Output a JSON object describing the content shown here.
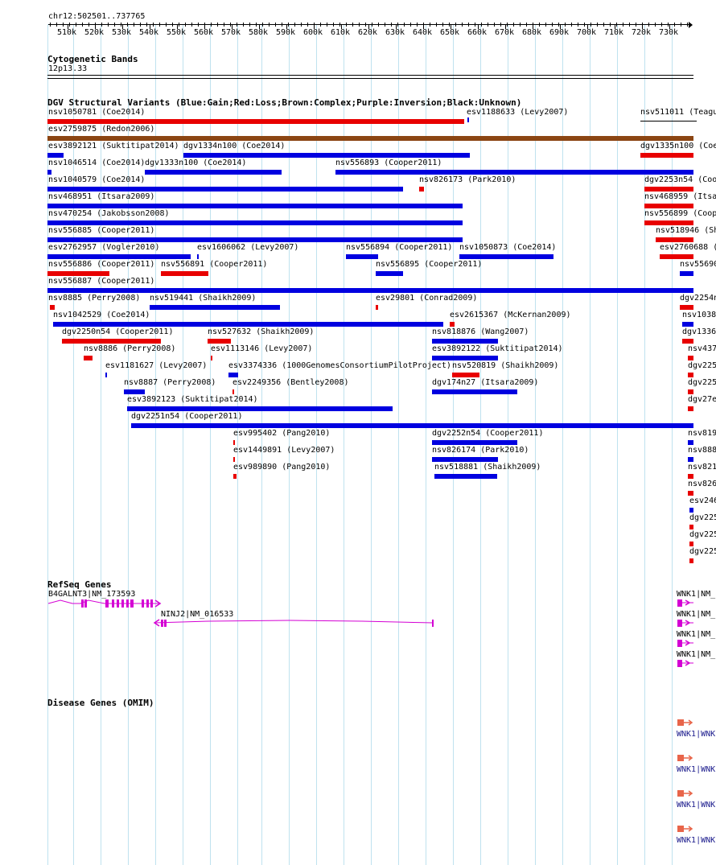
{
  "ruler": {
    "range_label": "chr12:502501..737765",
    "ticks": [
      "510k",
      "520k",
      "530k",
      "540k",
      "550k",
      "560k",
      "570k",
      "580k",
      "590k",
      "600k",
      "610k",
      "620k",
      "630k",
      "640k",
      "650k",
      "660k",
      "670k",
      "680k",
      "690k",
      "700k",
      "710k",
      "720k",
      "730k"
    ]
  },
  "cytoband": {
    "title": "Cytogenetic Bands",
    "band": "12p13.33"
  },
  "dgv": {
    "title": "DGV Structural Variants (Blue:Gain;Red:Loss;Brown:Complex;Purple:Inversion;Black:Unknown)",
    "colors": {
      "gain": "#0000e0",
      "loss": "#e80000",
      "complex": "#8b4513",
      "unknown": "#000000"
    },
    "variants": [
      {
        "label": "nsv1050781 (Coe2014)",
        "type": "loss"
      },
      {
        "label": "esv1188633 (Levy2007)",
        "type": "gain"
      },
      {
        "label": "nsv511011 (Teagu",
        "type": "unknown"
      },
      {
        "label": "esv2759875 (Redon2006)",
        "type": "complex"
      },
      {
        "label": "esv3892121 (Suktitipat2014)",
        "type": "gain"
      },
      {
        "label": "dgv1334n100 (Coe2014)",
        "type": "gain"
      },
      {
        "label": "dgv1335n100 (Coe",
        "type": "loss"
      },
      {
        "label": "nsv1046514 (Coe2014)",
        "type": "gain"
      },
      {
        "label": "dgv1333n100 (Coe2014)",
        "type": "gain"
      },
      {
        "label": "nsv556893 (Cooper2011)",
        "type": "gain"
      },
      {
        "label": "nsv1040579 (Coe2014)",
        "type": "gain"
      },
      {
        "label": "nsv826173 (Park2010)",
        "type": "loss"
      },
      {
        "label": "dgv2253n54 (Coo",
        "type": "loss"
      },
      {
        "label": "nsv468951 (Itsara2009)",
        "type": "gain"
      },
      {
        "label": "nsv468959 (Itsa",
        "type": "loss"
      },
      {
        "label": "nsv470254 (Jakobsson2008)",
        "type": "gain"
      },
      {
        "label": "nsv556899 (Coop",
        "type": "loss"
      },
      {
        "label": "nsv556885 (Cooper2011)",
        "type": "gain"
      },
      {
        "label": "nsv518946 (Sh",
        "type": "loss"
      },
      {
        "label": "esv2762957 (Vogler2010)",
        "type": "gain"
      },
      {
        "label": "esv1606062 (Levy2007)",
        "type": "gain"
      },
      {
        "label": "nsv556894 (Cooper2011)",
        "type": "gain"
      },
      {
        "label": "nsv1050873 (Coe2014)",
        "type": "gain"
      },
      {
        "label": "esv2760688 (",
        "type": "loss"
      },
      {
        "label": "nsv556886 (Cooper2011)",
        "type": "loss"
      },
      {
        "label": "nsv556891 (Cooper2011)",
        "type": "loss"
      },
      {
        "label": "nsv556895 (Cooper2011)",
        "type": "gain"
      },
      {
        "label": "nsv55690",
        "type": "gain"
      },
      {
        "label": "nsv556887 (Cooper2011)",
        "type": "gain"
      },
      {
        "label": "nsv8885 (Perry2008)",
        "type": "loss"
      },
      {
        "label": "nsv519441 (Shaikh2009)",
        "type": "gain"
      },
      {
        "label": "esv29801 (Conrad2009)",
        "type": "loss"
      },
      {
        "label": "dgv2254n",
        "type": "loss"
      },
      {
        "label": "nsv1042529 (Coe2014)",
        "type": "gain"
      },
      {
        "label": "esv2615367 (McKernan2009)",
        "type": "loss"
      },
      {
        "label": "nsv1038",
        "type": "gain"
      },
      {
        "label": "dgv2250n54 (Cooper2011)",
        "type": "loss"
      },
      {
        "label": "nsv527632 (Shaikh2009)",
        "type": "loss"
      },
      {
        "label": "nsv818876 (Wang2007)",
        "type": "gain"
      },
      {
        "label": "dgv1336",
        "type": "loss"
      },
      {
        "label": "nsv8886 (Perry2008)",
        "type": "loss"
      },
      {
        "label": "esv1113146 (Levy2007)",
        "type": "loss"
      },
      {
        "label": "esv3892122 (Suktitipat2014)",
        "type": "gain"
      },
      {
        "label": "nsv437",
        "type": "loss"
      },
      {
        "label": "esv1181627 (Levy2007)",
        "type": "gain"
      },
      {
        "label": "esv3374336 (1000GenomesConsortiumPilotProject)",
        "type": "gain"
      },
      {
        "label": "nsv520819 (Shaikh2009)",
        "type": "loss"
      },
      {
        "label": "dgv225",
        "type": "loss"
      },
      {
        "label": "nsv8887 (Perry2008)",
        "type": "gain"
      },
      {
        "label": "esv2249356 (Bentley2008)",
        "type": "loss"
      },
      {
        "label": "dgv174n27 (Itsara2009)",
        "type": "gain"
      },
      {
        "label": "dgv225",
        "type": "loss"
      },
      {
        "label": "esv3892123 (Suktitipat2014)",
        "type": "gain"
      },
      {
        "label": "dgv27e",
        "type": "loss"
      },
      {
        "label": "dgv2251n54 (Cooper2011)",
        "type": "gain"
      },
      {
        "label": "esv995402 (Pang2010)",
        "type": "loss"
      },
      {
        "label": "dgv2252n54 (Cooper2011)",
        "type": "gain"
      },
      {
        "label": "nsv819",
        "type": "gain"
      },
      {
        "label": "esv1449891 (Levy2007)",
        "type": "loss"
      },
      {
        "label": "nsv826174 (Park2010)",
        "type": "gain"
      },
      {
        "label": "nsv888",
        "type": "gain"
      },
      {
        "label": "esv989890 (Pang2010)",
        "type": "loss"
      },
      {
        "label": "nsv518881 (Shaikh2009)",
        "type": "gain"
      },
      {
        "label": "nsv821",
        "type": "loss"
      },
      {
        "label": "nsv826",
        "type": "loss"
      },
      {
        "label": "esv246",
        "type": "gain"
      },
      {
        "label": "dgv225",
        "type": "loss"
      },
      {
        "label": "dgv225",
        "type": "loss"
      },
      {
        "label": "dgv225",
        "type": "loss"
      }
    ]
  },
  "refseq": {
    "title": "RefSeq Genes",
    "color": "#d400d4",
    "genes": [
      {
        "label": "B4GALNT3|NM_173593"
      },
      {
        "label": "NINJ2|NM_016533"
      },
      {
        "label": "WNK1|NM_"
      },
      {
        "label": "WNK1|NM_"
      },
      {
        "label": "WNK1|NM_"
      },
      {
        "label": "WNK1|NM_"
      }
    ]
  },
  "omim": {
    "title": "Disease Genes (OMIM)",
    "color": "#e8654a",
    "genes": [
      {
        "label": "WNK1|WNK"
      },
      {
        "label": "WNK1|WNK"
      },
      {
        "label": "WNK1|WNK"
      },
      {
        "label": "WNK1|WNK"
      }
    ]
  }
}
